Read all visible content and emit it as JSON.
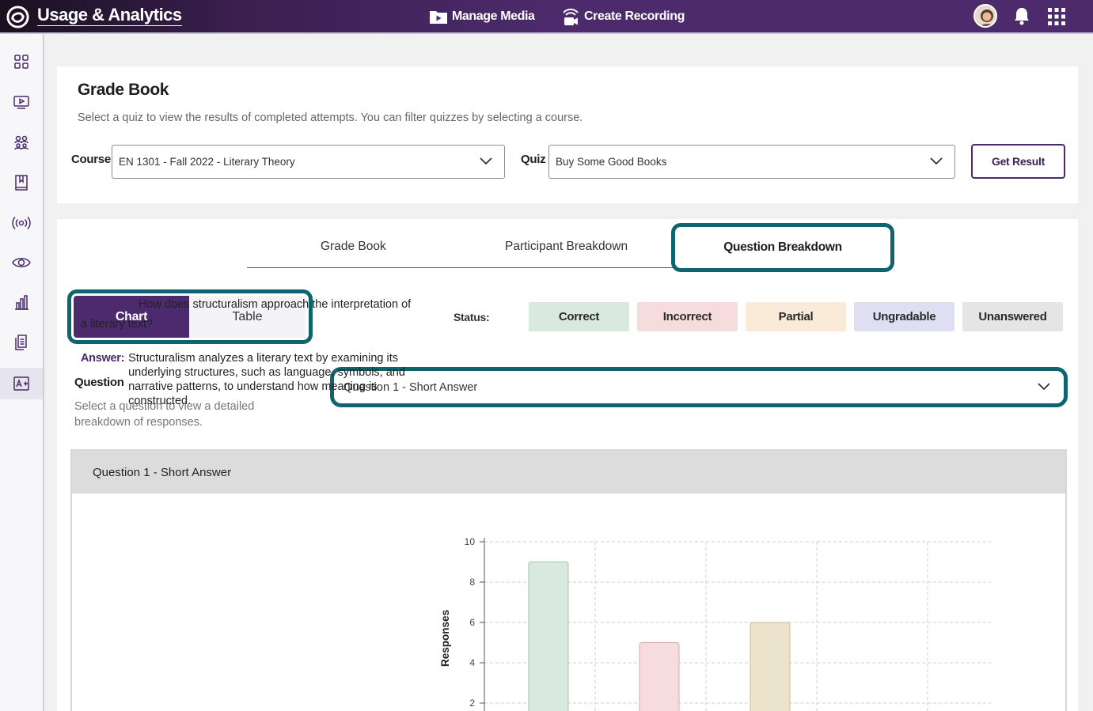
{
  "header": {
    "app_title": "Usage & Analytics",
    "nav": [
      {
        "label": "Manage Media",
        "icon": "media-folder-icon"
      },
      {
        "label": "Create Recording",
        "icon": "recording-icon"
      }
    ]
  },
  "sidebar": {
    "items": [
      {
        "icon": "dashboard-icon"
      },
      {
        "icon": "video-icon"
      },
      {
        "icon": "groups-icon"
      },
      {
        "icon": "book-icon"
      },
      {
        "icon": "broadcast-icon"
      },
      {
        "icon": "eye-icon"
      },
      {
        "icon": "analytics-icon"
      },
      {
        "icon": "documents-icon"
      },
      {
        "icon": "gradebook-icon",
        "active": true
      }
    ]
  },
  "gradebook": {
    "title": "Grade Book",
    "subtitle": "Select a quiz to view the results of completed attempts. You can filter quizzes by selecting a course.",
    "course_label": "Course",
    "course_value": "EN 1301 - Fall 2022 - Literary Theory",
    "quiz_label": "Quiz",
    "quiz_value": "Buy Some Good Books",
    "get_result_label": "Get Result"
  },
  "tabs": [
    {
      "label": "Grade Book"
    },
    {
      "label": "Participant Breakdown"
    },
    {
      "label": "Question Breakdown",
      "active": true
    }
  ],
  "view_toggle": {
    "chart_label": "Chart",
    "table_label": "Table",
    "selected": "Chart"
  },
  "status": {
    "label": "Status:",
    "items": [
      {
        "label": "Correct",
        "color": "#d9e9e0"
      },
      {
        "label": "Incorrect",
        "color": "#f6dcdd"
      },
      {
        "label": "Partial",
        "color": "#faebd8"
      },
      {
        "label": "Ungradable",
        "color": "#e0def3"
      },
      {
        "label": "Unanswered",
        "color": "#e5e5e5"
      }
    ]
  },
  "question_select": {
    "label": "Question",
    "help": "Select a question to view a detailed breakdown of responses.",
    "value": "Question 1 - Short Answer"
  },
  "question_detail": {
    "header": "Question 1 - Short Answer",
    "question_key": "Question:",
    "question_text": "How does structuralism approach the interpretation of a literary text?",
    "answer_key": "Answer:",
    "answer_text": "Structuralism analyzes a literary text by examining its underlying structures, such as language, symbols, and narrative patterns, to understand how meaning is constructed."
  },
  "chart_data": {
    "type": "bar",
    "ylabel": "Responses",
    "ylim": [
      0,
      10
    ],
    "yticks": [
      2,
      4,
      6,
      8,
      10
    ],
    "grid": true,
    "categories": [
      "Correct",
      "Incorrect",
      "Partial",
      "Ungradable",
      "Unanswered"
    ],
    "values": [
      9,
      5,
      6,
      0,
      0
    ],
    "colors": [
      "#d9e9e0",
      "#f6dcdd",
      "#ece3cc",
      "#e0def3",
      "#e5e5e5"
    ],
    "stroke_colors": [
      "#9cc5ad",
      "#dba8aa",
      "#cdbb8d",
      "#b7b2da",
      "#bdbdbd"
    ]
  }
}
